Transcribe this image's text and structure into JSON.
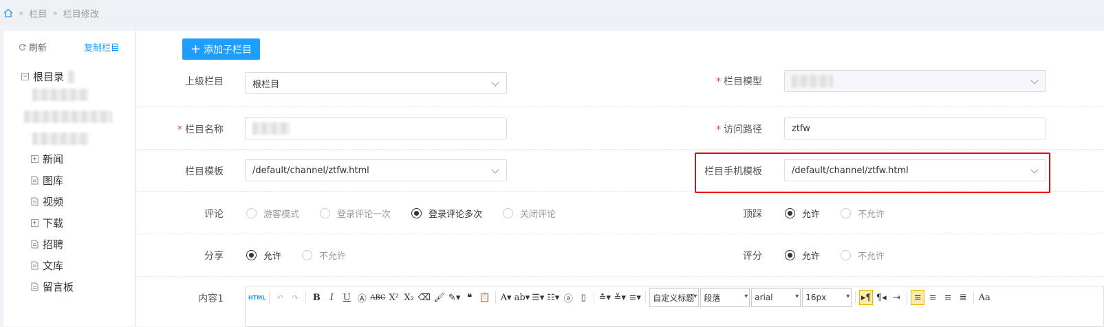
{
  "breadcrumb": {
    "sep": "»",
    "items": [
      "栏目",
      "栏目修改"
    ]
  },
  "sidebar": {
    "refresh": "刷新",
    "copy": "复制栏目",
    "tree": {
      "root": "根目录",
      "items": [
        "新闻",
        "图库",
        "视频",
        "下载",
        "招聘",
        "文库",
        "留言板"
      ]
    }
  },
  "form": {
    "add_child": "添加子栏目",
    "parent_label": "上级栏目",
    "parent_value": "根栏目",
    "model_label": "栏目模型",
    "name_label": "栏目名称",
    "path_label": "访问路径",
    "path_value": "ztfw",
    "template_label": "栏目模板",
    "template_value": "/default/channel/ztfw.html",
    "mobile_template_label": "栏目手机模板",
    "mobile_template_value": "/default/channel/ztfw.html",
    "comment_label": "评论",
    "comment_options": [
      "游客模式",
      "登录评论一次",
      "登录评论多次",
      "关闭评论"
    ],
    "vote_label": "顶踩",
    "share_label": "分享",
    "rate_label": "评分",
    "allow": "允许",
    "deny": "不允许",
    "content_label": "内容1",
    "required_mark": "*"
  },
  "editor": {
    "html": "HTML",
    "custom_title": "自定义标题",
    "paragraph": "段落",
    "font": "arial",
    "size": "16px"
  },
  "colors": {
    "primary": "#1E9FFF",
    "highlight": "#ee0000"
  }
}
